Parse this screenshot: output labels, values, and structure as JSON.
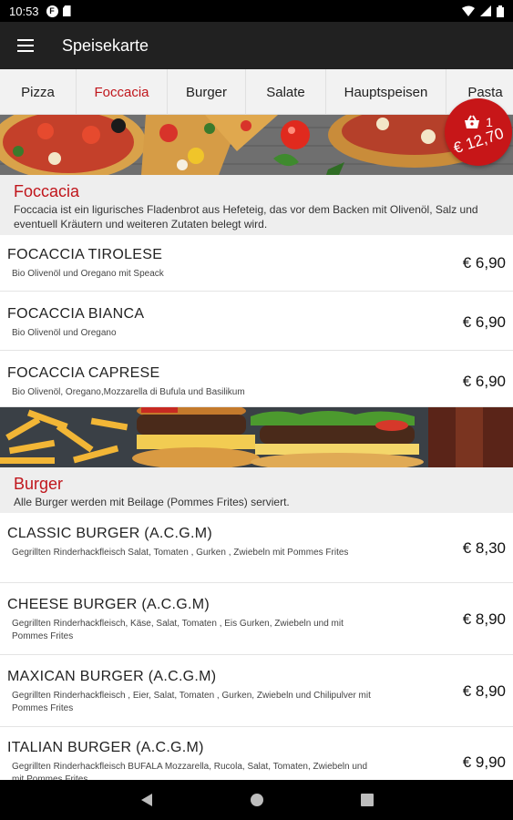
{
  "status": {
    "time": "10:53"
  },
  "toolbar": {
    "title": "Speisekarte"
  },
  "tabs": [
    {
      "label": "Pizza"
    },
    {
      "label": "Foccacia",
      "active": true
    },
    {
      "label": "Burger"
    },
    {
      "label": "Salate"
    },
    {
      "label": "Hauptspeisen"
    },
    {
      "label": "Pasta"
    }
  ],
  "cart": {
    "count": "1",
    "total": "€ 12,70",
    "icon": "shopping-basket-icon",
    "color": "#c71618"
  },
  "accent_color": "#c0161c",
  "sections": [
    {
      "name": "Foccacia",
      "description": "Foccacia ist ein ligurisches Fladenbrot aus Hefeteig, das vor dem Backen mit Olivenöl, Salz und eventuell Kräutern und weiteren Zutaten belegt wird.",
      "items": [
        {
          "name": "FOCACCIA TIROLESE",
          "description": "Bio Olivenöl und Oregano mit Speack",
          "price": "€ 6,90"
        },
        {
          "name": "FOCACCIA BIANCA",
          "description": "Bio Olivenöl und Oregano",
          "price": "€ 6,90"
        },
        {
          "name": "FOCACCIA CAPRESE",
          "description": "Bio Olivenöl, Oregano,Mozzarella di Bufula und Basilikum",
          "price": "€ 6,90"
        }
      ]
    },
    {
      "name": "Burger",
      "description": "Alle Burger werden mit Beilage (Pommes Frites) serviert.",
      "items": [
        {
          "name": "CLASSIC BURGER (A.C.G.M)",
          "description": "Gegrillten Rinderhackfleisch Salat, Tomaten , Gurken , Zwiebeln mit Pommes Frites",
          "price": "€ 8,30"
        },
        {
          "name": "CHEESE BURGER (A.C.G.M)",
          "description": "Gegrillten Rinderhackfleisch, Käse, Salat, Tomaten , Eis Gurken, Zwiebeln und mit Pommes Frites",
          "price": "€ 8,90"
        },
        {
          "name": "MAXICAN BURGER (A.C.G.M)",
          "description": "Gegrillten Rinderhackfleisch , Eier, Salat, Tomaten , Gurken, Zwiebeln  und Chilipulver mit Pommes Frites",
          "price": "€ 8,90"
        },
        {
          "name": "ITALIAN BURGER (A.C.G.M)",
          "description": "Gegrillten Rinderhackfleisch BUFALA Mozzarella, Rucola, Salat, Tomaten, Zwiebeln und mit Pommes Frites",
          "price": "€ 9,90"
        }
      ]
    }
  ]
}
